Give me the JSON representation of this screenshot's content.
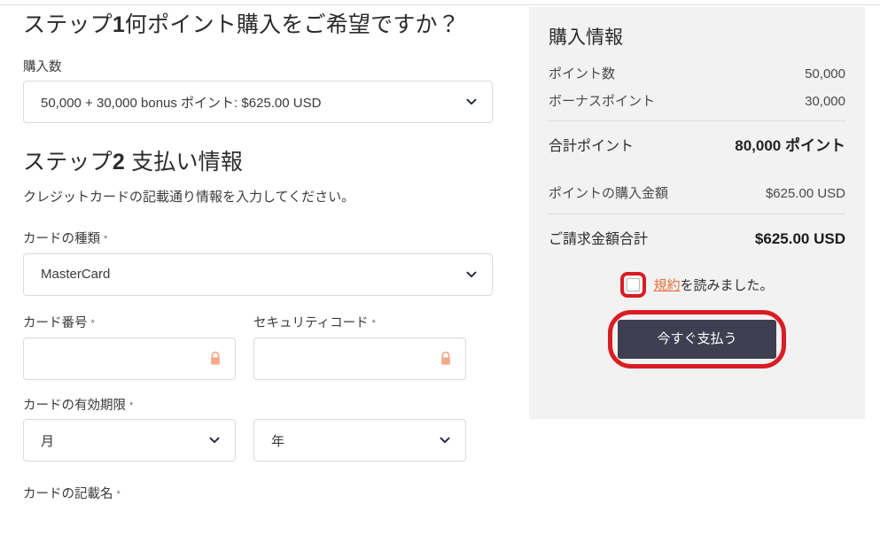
{
  "step1": {
    "heading_prefix": "ステップ",
    "heading_num": "1",
    "heading_rest": "何ポイント購入をご希望ですか？",
    "quantity_label": "購入数",
    "quantity_value": "50,000 + 30,000 bonus ポイント: $625.00 USD",
    "chevron_icon": "chevron-down-icon"
  },
  "step2": {
    "heading_prefix": "ステップ",
    "heading_num": "2",
    "heading_rest": " 支払い情報",
    "description": "クレジットカードの記載通り情報を入力してください。",
    "card_type_label": "カードの種類",
    "card_type_value": "MasterCard",
    "card_number_label": "カード番号",
    "card_number_value": "",
    "card_number_placeholder": "",
    "security_code_label": "セキュリティコード",
    "security_code_value": "",
    "security_code_placeholder": "",
    "expiry_label": "カードの有効期限",
    "expiry_month_value": "月",
    "expiry_year_value": "年",
    "cardholder_label": "カードの記載名",
    "required_mark": "*",
    "lock_icon": "lock-icon"
  },
  "summary": {
    "title": "購入情報",
    "rows": [
      {
        "label": "ポイント数",
        "value": "50,000"
      },
      {
        "label": "ボーナスポイント",
        "value": "30,000"
      }
    ],
    "total_points": {
      "label": "合計ポイント",
      "value": "80,000 ポイント"
    },
    "purchase_amount": {
      "label": "ポイントの購入金額",
      "value": "$625.00 USD"
    },
    "grand_total": {
      "label": "ご請求金額合計",
      "value": "$625.00 USD"
    },
    "terms": {
      "link_text": "規約",
      "rest_text": "を読みました。",
      "checkbox_icon": "checkbox-unchecked-icon",
      "checked": false
    },
    "pay_button_label": "今すぐ支払う"
  },
  "colors": {
    "panel_bg": "#f2f2f2",
    "pay_button_bg": "#3f3f51",
    "annotation_red": "#d81d24",
    "link_orange": "#e2703a",
    "lock_peach": "#f6a98a",
    "border_gray": "#dadada"
  }
}
